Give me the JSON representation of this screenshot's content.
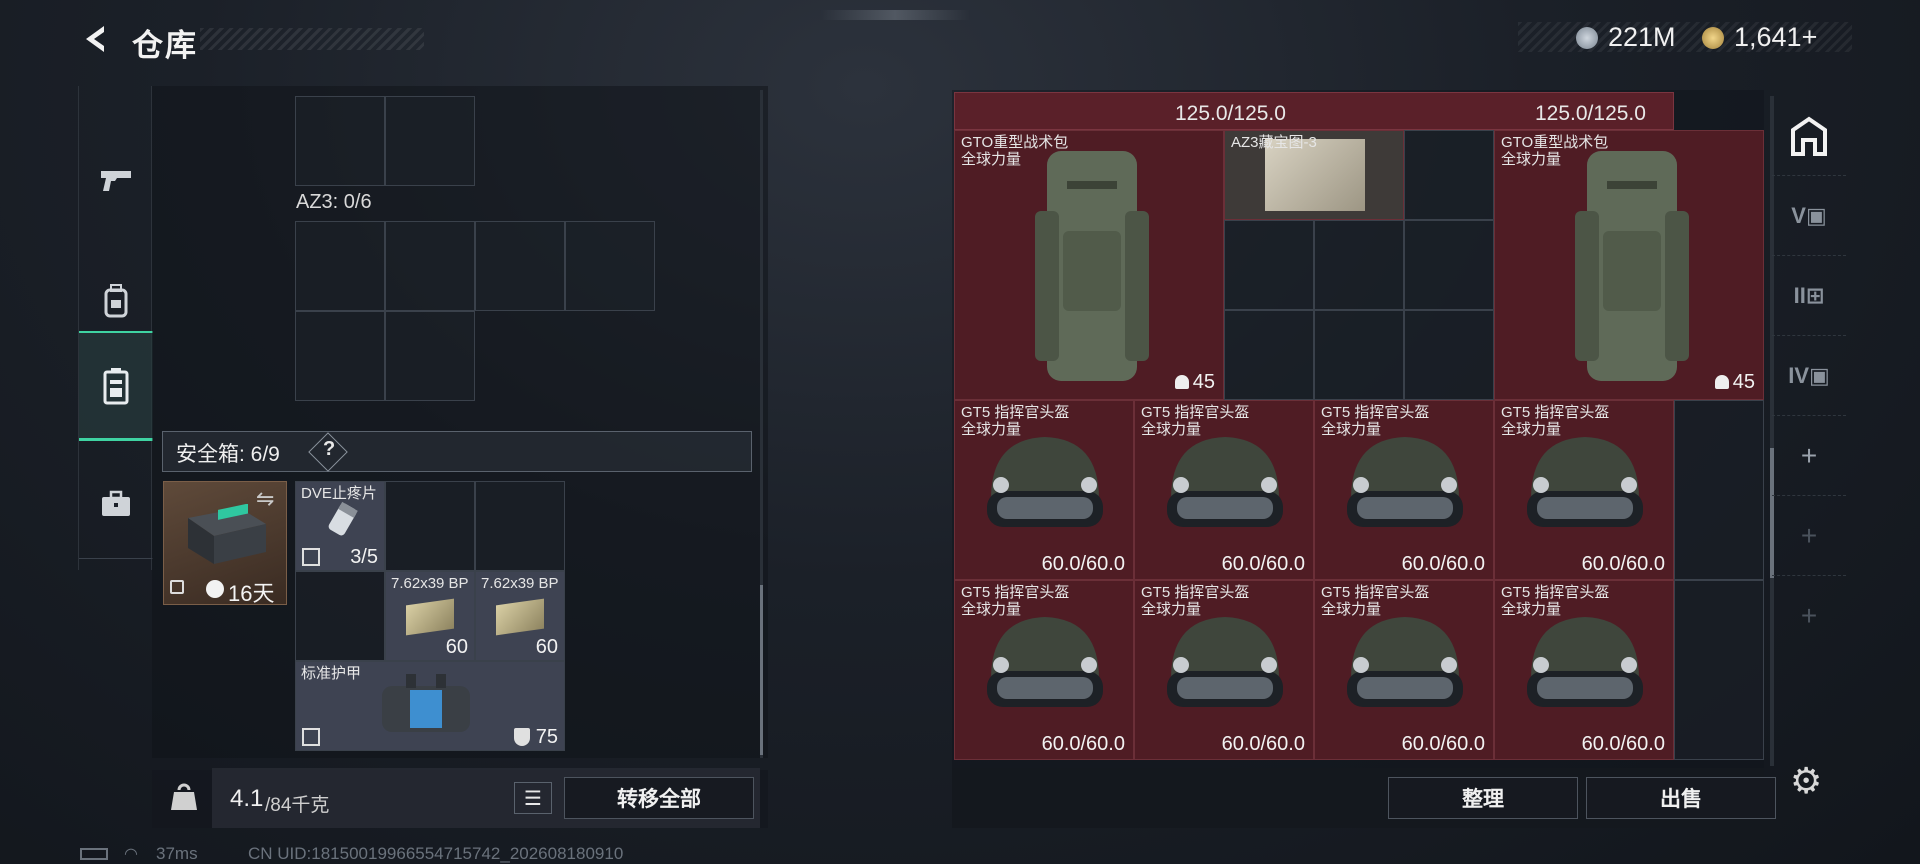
{
  "header": {
    "title": "仓库",
    "currency": [
      {
        "icon": "silver-coin-icon",
        "amount": "221M"
      },
      {
        "icon": "gold-coin-icon",
        "amount": "1,641+"
      }
    ]
  },
  "sidebar": {
    "items": [
      {
        "icon": "pistol-icon",
        "active": false
      },
      {
        "icon": "backpack-icon",
        "active": false
      },
      {
        "icon": "safe-box-icon",
        "active": true
      },
      {
        "icon": "briefcase-icon",
        "active": false
      }
    ]
  },
  "left": {
    "container_label": "AZ3: 0/6",
    "safe_label": "安全箱: 6/9",
    "safe_help": "?",
    "safe_item": {
      "duration": "16天"
    },
    "items": [
      {
        "name": "DVE止疼片",
        "value": "3/5"
      },
      {
        "name": "7.62x39 BP",
        "value": "60"
      },
      {
        "name": "7.62x39 BP",
        "value": "60"
      },
      {
        "name": "标准护甲",
        "value": "75"
      }
    ],
    "weight_value": "4.1",
    "weight_unit": "/84千克",
    "transfer_all": "转移全部"
  },
  "right": {
    "top_values": [
      "125.0/125.0",
      "125.0/125.0"
    ],
    "backpacks": [
      {
        "name": "GTO重型战术包",
        "sub": "全球力量",
        "value": "45"
      },
      {
        "name": "GTO重型战术包",
        "sub": "全球力量",
        "value": "45"
      }
    ],
    "map_item": {
      "name": "AZ3藏宝图-3"
    },
    "helmets": [
      {
        "name": "GT5 指挥官头盔",
        "sub": "全球力量",
        "value": "60.0/60.0"
      },
      {
        "name": "GT5 指挥官头盔",
        "sub": "全球力量",
        "value": "60.0/60.0"
      },
      {
        "name": "GT5 指挥官头盔",
        "sub": "全球力量",
        "value": "60.0/60.0"
      },
      {
        "name": "GT5 指挥官头盔",
        "sub": "全球力量",
        "value": "60.0/60.0"
      },
      {
        "name": "GT5 指挥官头盔",
        "sub": "全球力量",
        "value": "60.0/60.0"
      },
      {
        "name": "GT5 指挥官头盔",
        "sub": "全球力量",
        "value": "60.0/60.0"
      },
      {
        "name": "GT5 指挥官头盔",
        "sub": "全球力量",
        "value": "60.0/60.0"
      },
      {
        "name": "GT5 指挥官头盔",
        "sub": "全球力量",
        "value": "60.0/60.0"
      }
    ],
    "sort_button": "整理",
    "sell_button": "出售"
  },
  "status": {
    "ping": "37ms",
    "uid": "CN UID:18150019966554715742_202608180910"
  },
  "colors": {
    "accent": "#3fd3a2",
    "item_red": "#5a2029",
    "panel": "#1b2028"
  }
}
